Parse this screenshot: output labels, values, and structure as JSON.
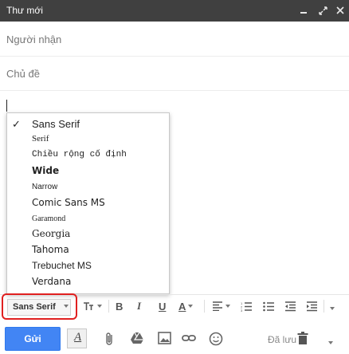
{
  "window": {
    "title": "Thư mới"
  },
  "fields": {
    "recipients_placeholder": "Người nhận",
    "subject_placeholder": "Chủ đề"
  },
  "font_menu": {
    "items": [
      {
        "label": "Sans Serif",
        "selected": true
      },
      {
        "label": "Serif",
        "selected": false
      },
      {
        "label": "Chiều rộng cố định",
        "selected": false
      },
      {
        "label": "Wide",
        "selected": false
      },
      {
        "label": "Narrow",
        "selected": false
      },
      {
        "label": "Comic Sans MS",
        "selected": false
      },
      {
        "label": "Garamond",
        "selected": false
      },
      {
        "label": "Georgia",
        "selected": false
      },
      {
        "label": "Tahoma",
        "selected": false
      },
      {
        "label": "Trebuchet MS",
        "selected": false
      },
      {
        "label": "Verdana",
        "selected": false
      }
    ]
  },
  "toolbar": {
    "font_select_value": "Sans Serif",
    "size_icon": "text-size-icon",
    "bold_icon": "bold-icon",
    "italic_icon": "italic-icon",
    "underline_icon": "underline-icon",
    "text_color_icon": "text-color-icon",
    "align_icon": "align-icon",
    "numbered_list_icon": "numbered-list-icon",
    "bulleted_list_icon": "bulleted-list-icon",
    "indent_less_icon": "indent-less-icon",
    "indent_more_icon": "indent-more-icon",
    "more_icon": "more-formatting-icon"
  },
  "bottom_bar": {
    "send_label": "Gửi",
    "saved_label": "Đã lưu",
    "accent_color": "#4285f4"
  },
  "colors": {
    "titlebar": "#404040",
    "highlight": "#e02020"
  }
}
